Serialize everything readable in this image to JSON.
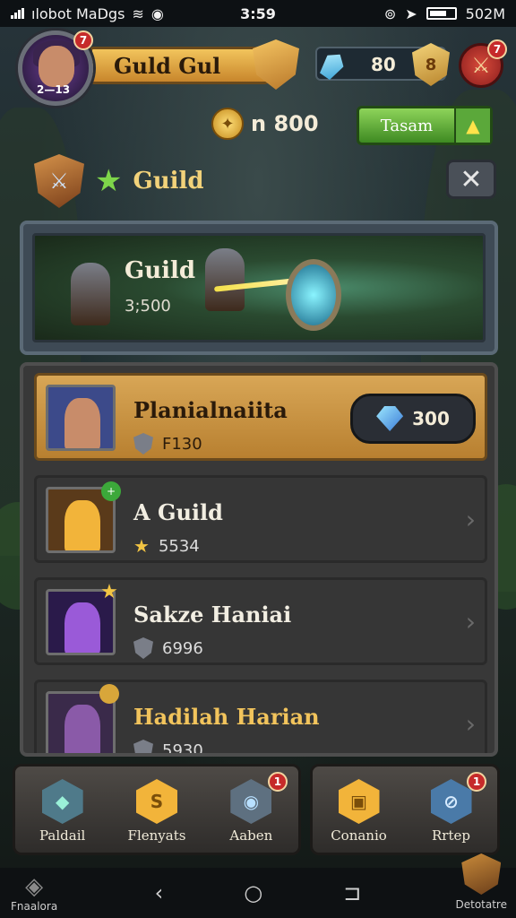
{
  "status_bar": {
    "carrier": "ılobot MaDgs",
    "time": "3:59",
    "battery_text": "502M"
  },
  "header": {
    "player_level": "2—13",
    "avatar_badge": "7",
    "name": "Guld Gul",
    "gem_value": "80",
    "gem_coin_symbol": "8",
    "settings_badge": "7"
  },
  "resources": {
    "coins": "n 800",
    "action_button": "Tasam"
  },
  "guild": {
    "title": "Guild",
    "close_symbol": "✕"
  },
  "banner": {
    "title": "Guild",
    "value": "3;500"
  },
  "members": [
    {
      "name": "Planialnaiita",
      "stat": "F130",
      "price": "300",
      "active": true,
      "thumb_color": "#3c4a8a",
      "figure_color": "#c88c6a",
      "stat_icon": "shield"
    },
    {
      "name": "A Guild",
      "stat": "5534",
      "active": false,
      "thumb_color": "#5a3a1a",
      "figure_color": "#f2b43a",
      "stat_icon": "star"
    },
    {
      "name": "Sakze Haniai",
      "stat": "6996",
      "active": false,
      "thumb_color": "#2a1a4a",
      "figure_color": "#9a5ad8",
      "stat_icon": "shield"
    },
    {
      "name": "Hadilah Harian",
      "stat": "5930",
      "active": false,
      "thumb_color": "#3a2a4a",
      "figure_color": "#8a5aa8",
      "stat_icon": "shield"
    }
  ],
  "bottom_nav": {
    "items": [
      {
        "label": "Paldail",
        "symbol": "◆",
        "color": "#4f7a8a"
      },
      {
        "label": "Flenyats",
        "symbol": "S",
        "color": "#f2b43a"
      },
      {
        "label": "Aaben",
        "symbol": "◉",
        "color": "#5e7080",
        "badge": "1"
      },
      {
        "label": "Conanio",
        "symbol": "▣",
        "color": "#f2b43a"
      },
      {
        "label": "Rrtep",
        "symbol": "⊘",
        "color": "#4a7aa8",
        "badge": "1"
      }
    ]
  },
  "system_nav": {
    "left_label": "Fnaalora",
    "right_label": "Detotatre",
    "back": "‹",
    "home": "○",
    "recents": "⊐"
  },
  "colors": {
    "accent_gold": "#f2c45c",
    "accent_green": "#7ed64a",
    "badge_red": "#c62a2a"
  }
}
